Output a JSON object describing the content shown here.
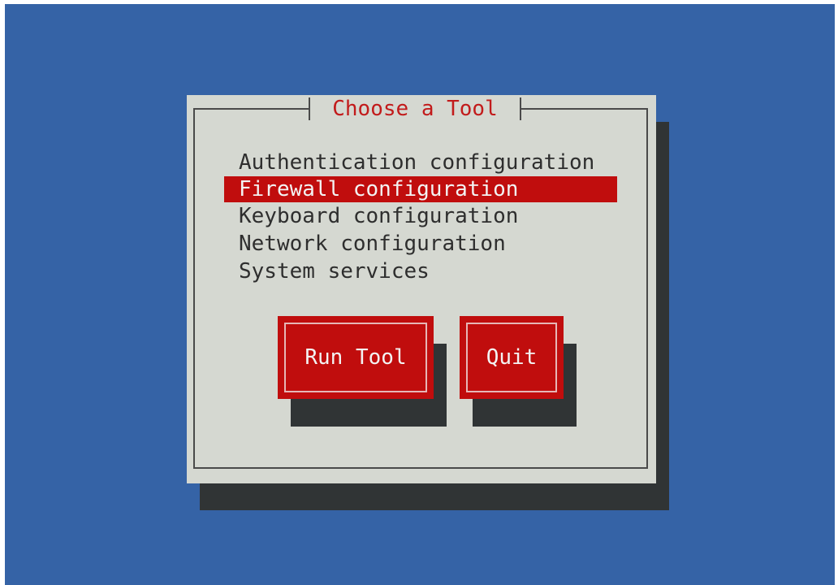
{
  "dialog": {
    "title": "Choose a Tool",
    "items": [
      {
        "label": "Authentication configuration",
        "selected": false
      },
      {
        "label": "Firewall configuration",
        "selected": true
      },
      {
        "label": "Keyboard configuration",
        "selected": false
      },
      {
        "label": "Network configuration",
        "selected": false
      },
      {
        "label": "System services",
        "selected": false
      }
    ],
    "buttons": {
      "run": "Run Tool",
      "quit": "Quit"
    }
  },
  "colors": {
    "background": "#3563a6",
    "dialog": "#d5d8d1",
    "shadow": "#303435",
    "accent": "#c00d0d",
    "title_text": "#c21b1b",
    "text": "#2e2e2e"
  }
}
